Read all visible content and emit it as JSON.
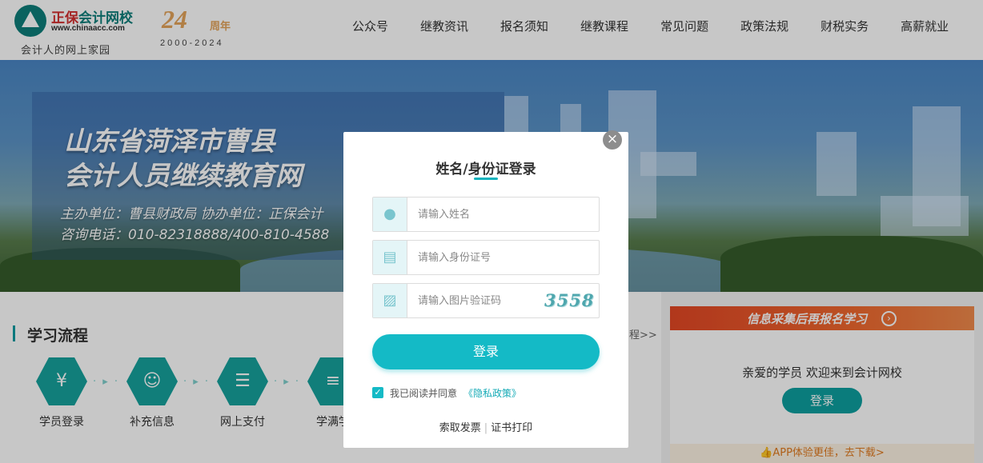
{
  "header": {
    "logo_name_a": "正保",
    "logo_name_b": "会计网校",
    "logo_url": "www.chinaacc.com",
    "logo_slogan": "会计人的网上家园",
    "anniv_number": "24",
    "anniv_word": "周年",
    "anniv_years": "2000-2024",
    "nav": [
      "公众号",
      "继教资讯",
      "报名须知",
      "继教课程",
      "常见问题",
      "政策法规",
      "财税实务",
      "高薪就业"
    ]
  },
  "banner": {
    "title_line1": "山东省菏泽市曹县",
    "title_line2": "会计人员继续教育网",
    "sponsor": "主办单位：曹县财政局 协办单位：正保会计",
    "hotline": "咨询电话：010-82318888/400-810-4588"
  },
  "process": {
    "title": "学习流程",
    "more": "程>>",
    "steps": [
      {
        "icon": "money-bag-icon",
        "label": "学员登录"
      },
      {
        "icon": "user-check-icon",
        "label": "补充信息"
      },
      {
        "icon": "clipboard-icon",
        "label": "网上支付"
      },
      {
        "icon": "certificate-icon",
        "label": "学满学"
      }
    ]
  },
  "side": {
    "header": "信息采集后再报名学习",
    "welcome": "亲爱的学员 欢迎来到会计网校",
    "login_label": "登录",
    "app_text": "APP体验更佳，去下载>"
  },
  "modal": {
    "title": "姓名/身份证登录",
    "name_placeholder": "请输入姓名",
    "id_placeholder": "请输入身份证号",
    "captcha_placeholder": "请输入图片验证码",
    "captcha_text": "3558",
    "login_label": "登录",
    "agree_text": "我已阅读并同意",
    "privacy_link": "《隐私政策》",
    "agree_checked": true,
    "link_invoice": "索取发票",
    "link_certificate": "证书打印"
  },
  "colors": {
    "teal": "#14bac6",
    "brand_green": "#0e7e7a",
    "orange_header": "#f0682e",
    "overlay": "rgba(0,0,0,0.22)"
  }
}
